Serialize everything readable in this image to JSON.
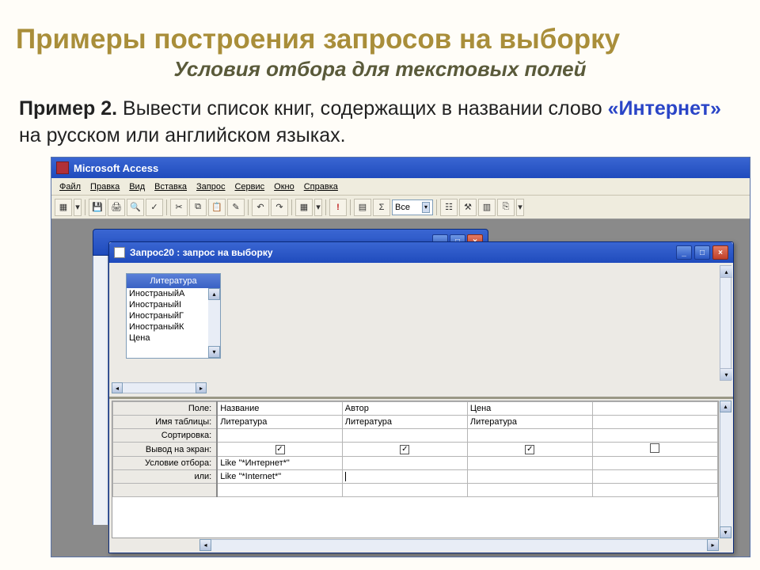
{
  "slide": {
    "title": "Примеры построения запросов на выборку",
    "subtitle": "Условия отбора для текстовых полей",
    "example_label": "Пример 2.",
    "example_text_1": " Вывести список книг,  содержащих в названии слово ",
    "example_keyword": "«Интернет»",
    "example_text_2": " на русском или английском языках."
  },
  "access": {
    "title": "Microsoft Access",
    "menu": [
      "Файл",
      "Правка",
      "Вид",
      "Вставка",
      "Запрос",
      "Сервис",
      "Окно",
      "Справка"
    ],
    "toolbar_dropdown": "Все"
  },
  "query_window": {
    "title": "Запрос20 : запрос на выборку",
    "table_name": "Литература",
    "fields": [
      "ИностраныйА",
      "ИностраныйI",
      "ИностраныйГ",
      "ИностраныйК",
      "Цена"
    ]
  },
  "grid": {
    "labels": {
      "field": "Поле:",
      "table": "Имя таблицы:",
      "sort": "Сортировка:",
      "show": "Вывод на экран:",
      "criteria": "Условие отбора:",
      "or": "или:"
    },
    "cols": [
      {
        "field": "Название",
        "table": "Литература",
        "show": true,
        "criteria": "Like \"*Интернет*\"",
        "or": "Like \"*Internet*\""
      },
      {
        "field": "Автор",
        "table": "Литература",
        "show": true,
        "criteria": "",
        "or": ""
      },
      {
        "field": "Цена",
        "table": "Литература",
        "show": true,
        "criteria": "",
        "or": ""
      },
      {
        "field": "",
        "table": "",
        "show": false,
        "criteria": "",
        "or": ""
      }
    ]
  }
}
